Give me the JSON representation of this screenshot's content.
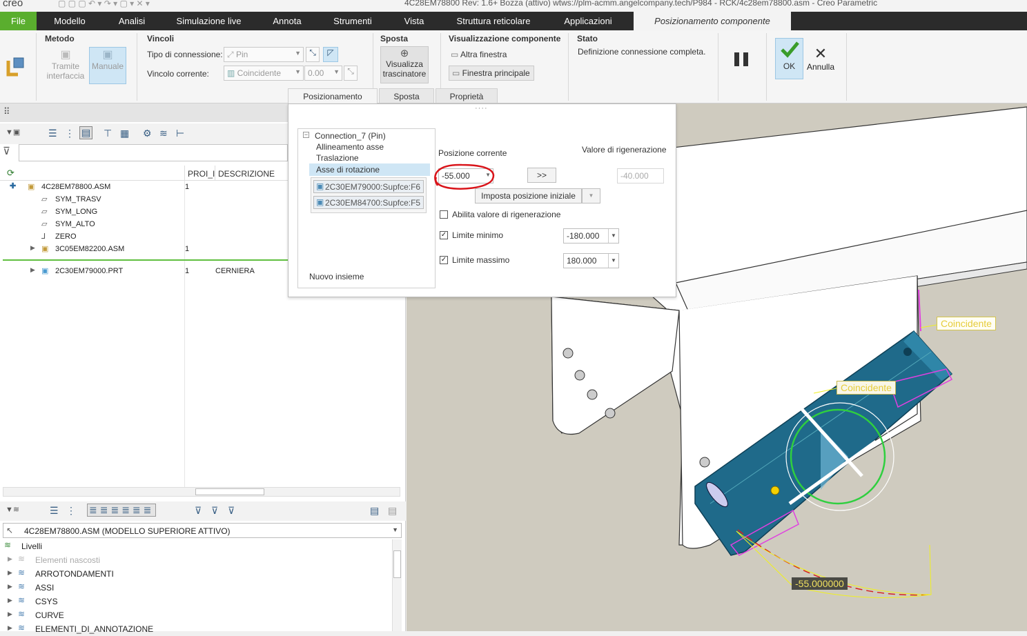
{
  "window": {
    "app_logo": "creo",
    "title": "4C28EM78800 Rev: 1.6+ Bozza  (attivo) wtws://plm-acmm.angelcompany.tech/P984 - RCK/4c28em78800.asm - Creo Parametric"
  },
  "tabs": [
    "File",
    "Modello",
    "Analisi",
    "Simulazione live",
    "Annota",
    "Strumenti",
    "Vista",
    "Struttura reticolare",
    "Applicazioni",
    "Posizionamento componente"
  ],
  "ribbon": {
    "metodo": {
      "title": "Metodo",
      "interfaccia": "Tramite interfaccia",
      "manuale": "Manuale"
    },
    "vincoli": {
      "title": "Vincoli",
      "tipo_label": "Tipo di connessione:",
      "tipo_value": "Pin",
      "corrente_label": "Vincolo corrente:",
      "corrente_value": "Coincidente",
      "offset_value": "0.00"
    },
    "sposta": {
      "title": "Sposta",
      "visualizza": "Visualizza trascinatore"
    },
    "visualizzazione": {
      "title": "Visualizzazione componente",
      "altra": "Altra finestra",
      "principale": "Finestra principale"
    },
    "stato": {
      "title": "Stato",
      "text": "Definizione connessione completa."
    },
    "ok": "OK",
    "annulla": "Annulla"
  },
  "subtabs": [
    "Posizionamento",
    "Sposta",
    "Proprietà"
  ],
  "model_tree": {
    "col_proi": "PROI_I",
    "col_desc": "DESCRIZIONE",
    "rows": [
      {
        "name": "4C28EM78800.ASM",
        "qty": "1",
        "desc": ""
      },
      {
        "name": "SYM_TRASV",
        "qty": "",
        "desc": ""
      },
      {
        "name": "SYM_LONG",
        "qty": "",
        "desc": ""
      },
      {
        "name": "SYM_ALTO",
        "qty": "",
        "desc": ""
      },
      {
        "name": "ZERO",
        "qty": "",
        "desc": ""
      },
      {
        "name": "3C05EM82200.ASM",
        "qty": "1",
        "desc": ""
      },
      {
        "name": "2C30EM79000.PRT",
        "qty": "1",
        "desc": "CERNIERA"
      }
    ]
  },
  "layer_tree": {
    "model_select": "4C28EM78800.ASM (MODELLO SUPERIORE ATTIVO)",
    "root": "Livelli",
    "items": [
      "Elementi nascosti",
      "ARROTONDAMENTI",
      "ASSI",
      "CSYS",
      "CURVE",
      "ELEMENTI_DI_ANNOTAZIONE"
    ]
  },
  "dialog": {
    "connection": "Connection_7 (Pin)",
    "children": [
      "Allineamento asse",
      "Traslazione",
      "Asse di rotazione"
    ],
    "refs": [
      "2C30EM79000:Supfce:F6",
      "2C30EM84700:Supfce:F5"
    ],
    "nuovo": "Nuovo insieme",
    "pos_label": "Posizione corrente",
    "pos_value": "-55.000",
    "arrow_btn": ">>",
    "regen_label": "Valore di rigenerazione",
    "regen_value": "-40.000",
    "imposta": "Imposta posizione iniziale",
    "abilita": "Abilita valore di rigenerazione",
    "min_label": "Limite minimo",
    "min_value": "-180.000",
    "max_label": "Limite massimo",
    "max_value": "180.000"
  },
  "viewport": {
    "label1": "Coincidente",
    "label2": "Coincidente",
    "angle": "-55.000000"
  }
}
